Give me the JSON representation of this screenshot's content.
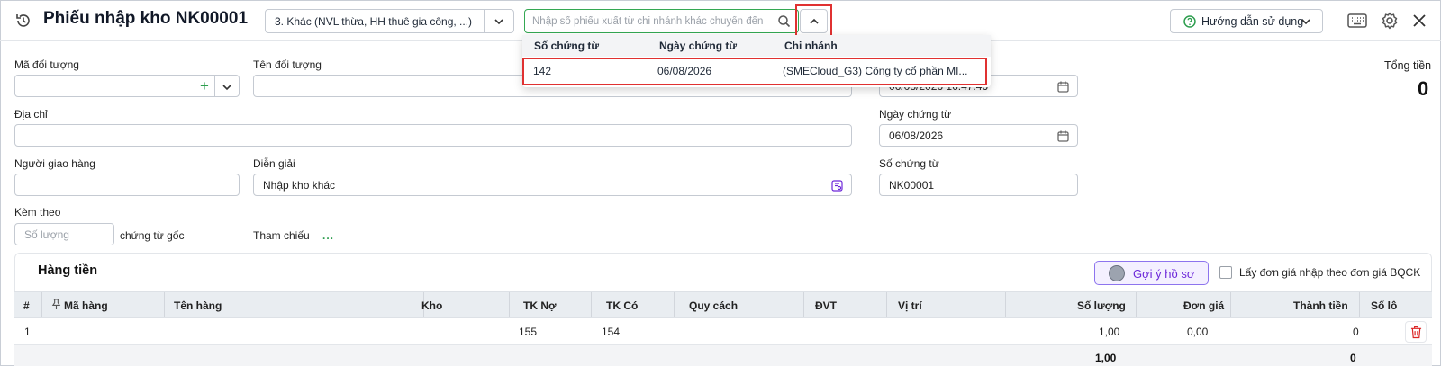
{
  "header": {
    "title": "Phiếu nhập kho NK00001",
    "category_value": "3. Khác (NVL thừa, HH thuê gia công, ...)",
    "search_placeholder": "Nhập số phiếu xuất từ chi nhánh khác chuyển đến",
    "guide_label": "Hướng dẫn sử dụng",
    "icons": [
      "history-icon",
      "chevron-down-icon",
      "search-icon",
      "chevron-up-icon",
      "help-circle-icon",
      "keyboard-icon",
      "gear-icon",
      "close-icon"
    ]
  },
  "dropdown": {
    "headers": [
      "Số chứng từ",
      "Ngày chứng từ",
      "Chi nhánh"
    ],
    "rows": [
      {
        "so_chung_tu": "142",
        "ngay_chung_tu": "06/08/2026",
        "chi_nhanh": "(SMECloud_G3) Công ty cổ phần MI..."
      }
    ]
  },
  "form": {
    "ma_doi_tuong_label": "Mã đối tượng",
    "ten_doi_tuong_label": "Tên đối tượng",
    "dia_chi_label": "Địa chỉ",
    "nguoi_giao_hang_label": "Người giao hàng",
    "dien_giai_label": "Diễn giải",
    "dien_giai_value": "Nhập kho khác",
    "kem_theo_label": "Kèm theo",
    "so_luong_placeholder": "Số lượng",
    "chung_tu_goc_label": "chứng từ gốc",
    "tham_chieu_label": "Tham chiếu",
    "tham_chieu_more": "...",
    "ngay_hach_toan_value": "06/08/2026 16:47:46",
    "ngay_chung_tu_label": "Ngày chứng từ",
    "ngay_chung_tu_value": "06/08/2026",
    "so_chung_tu_label": "Số chứng từ",
    "so_chung_tu_value": "NK00001",
    "tong_tien_label": "Tổng tiền",
    "tong_tien_value": "0"
  },
  "grid": {
    "title": "Hàng tiền",
    "suggest_label": "Gợi ý hồ sơ",
    "checkbox_label": "Lấy đơn giá nhập theo đơn giá BQCK",
    "checkbox_checked": false,
    "columns": [
      "#",
      "Mã hàng",
      "Tên hàng",
      "Kho",
      "TK Nợ",
      "TK Có",
      "Quy cách",
      "ĐVT",
      "Vị trí",
      "Số lượng",
      "Đơn giá",
      "Thành tiền",
      "Số lô"
    ],
    "rows": [
      {
        "stt": "1",
        "ma_hang": "",
        "ten_hang": "",
        "kho": "",
        "tk_no": "155",
        "tk_co": "154",
        "quy_cach": "",
        "dvt": "",
        "vi_tri": "",
        "so_luong": "1,00",
        "don_gia": "0,00",
        "thanh_tien": "0",
        "so_lo": ""
      }
    ],
    "footer": {
      "so_luong": "1,00",
      "thanh_tien": "0"
    }
  },
  "colors": {
    "accent_green": "#34a853",
    "highlight_red": "#e03131",
    "suggest_purple": "#6d28d9"
  }
}
